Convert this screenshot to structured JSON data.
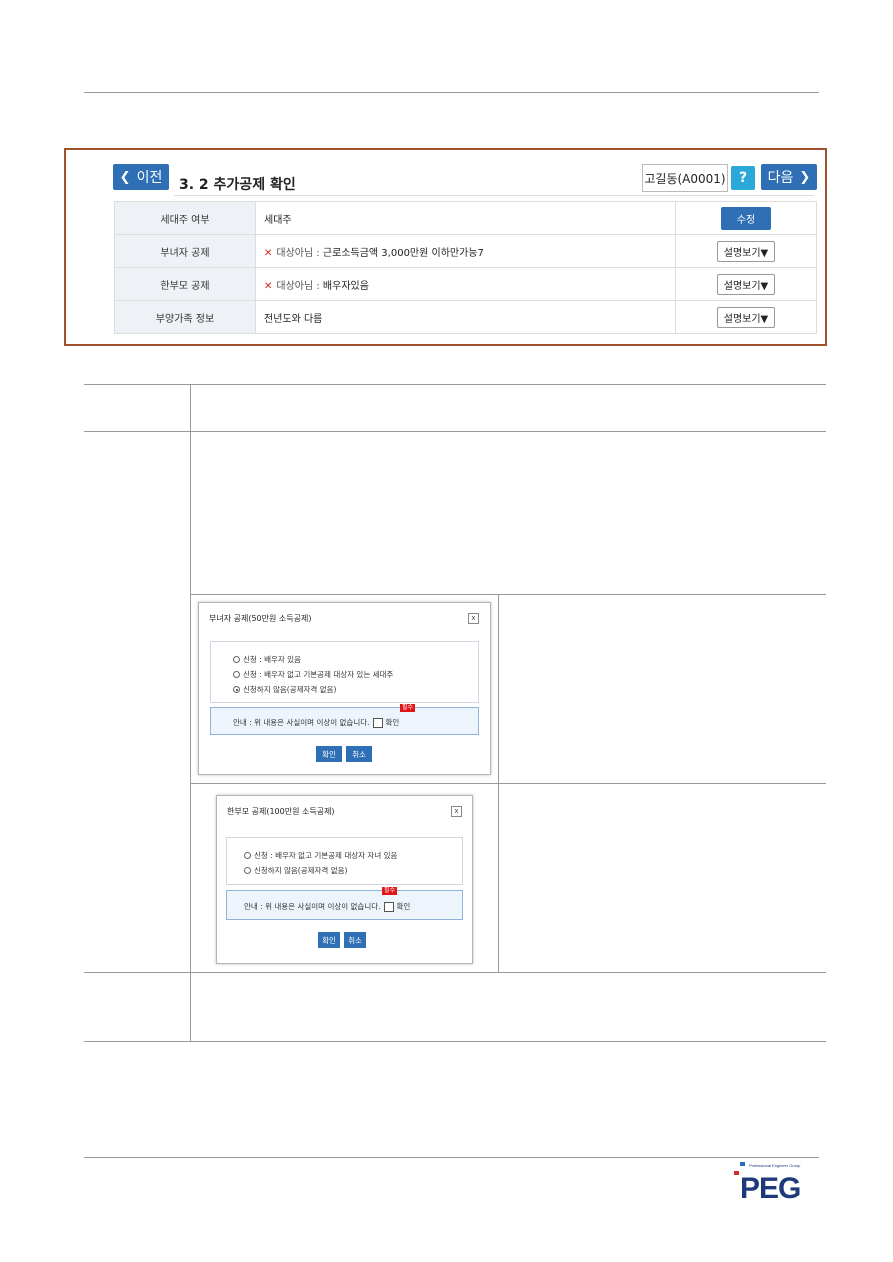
{
  "screen": {
    "prev_label": "이전",
    "section_title": "3. 2  추가공제 확인",
    "user": "고길동(A0001)",
    "help_label": "?",
    "next_label": "다음",
    "rows": [
      {
        "label": "세대주 여부",
        "value": "세대주",
        "action": "수정"
      },
      {
        "label": "부녀자 공제",
        "prefix": "대상아님 : ",
        "value": "근로소득금액 3,000만원 이하만가능7",
        "action": "설명보기▼"
      },
      {
        "label": "한부모 공제",
        "prefix": "대상아님 : ",
        "value": "배우자있음",
        "action": "설명보기▼"
      },
      {
        "label": "부양가족 정보",
        "value": "전년도와 다름",
        "action": "설명보기▼"
      }
    ]
  },
  "dialog1": {
    "title": "부녀자 공제(50만원 소득공제)",
    "close": "x",
    "options": [
      "신청 : 배우자 있음",
      "신청 : 배우자 없고 기본공제 대상자 있는 세대주",
      "신청하지 않음(공제자격 없음)"
    ],
    "notice": "안내 : 위 내용은 사실이며 이상이 없습니다.",
    "required": "필수",
    "check_label": "확인",
    "ok": "확인",
    "cancel": "취소"
  },
  "dialog2": {
    "title": "한부모 공제(100만원 소득공제)",
    "close": "x",
    "options": [
      "신청 : 배우자 없고 기본공제 대상자 자녀 있음",
      "신청하지 않음(공제자격 없음)"
    ],
    "notice": "안내 : 위 내용은 사실이며 이상이 없습니다.",
    "required": "필수",
    "check_label": "확인",
    "ok": "확인",
    "cancel": "취소"
  },
  "logo": {
    "tagline": "Professional Engineer Group",
    "text": "PEG",
    "colors": {
      "navy": "#1f3a7a",
      "red": "#d42a2a",
      "blue": "#2a6cc4"
    }
  }
}
